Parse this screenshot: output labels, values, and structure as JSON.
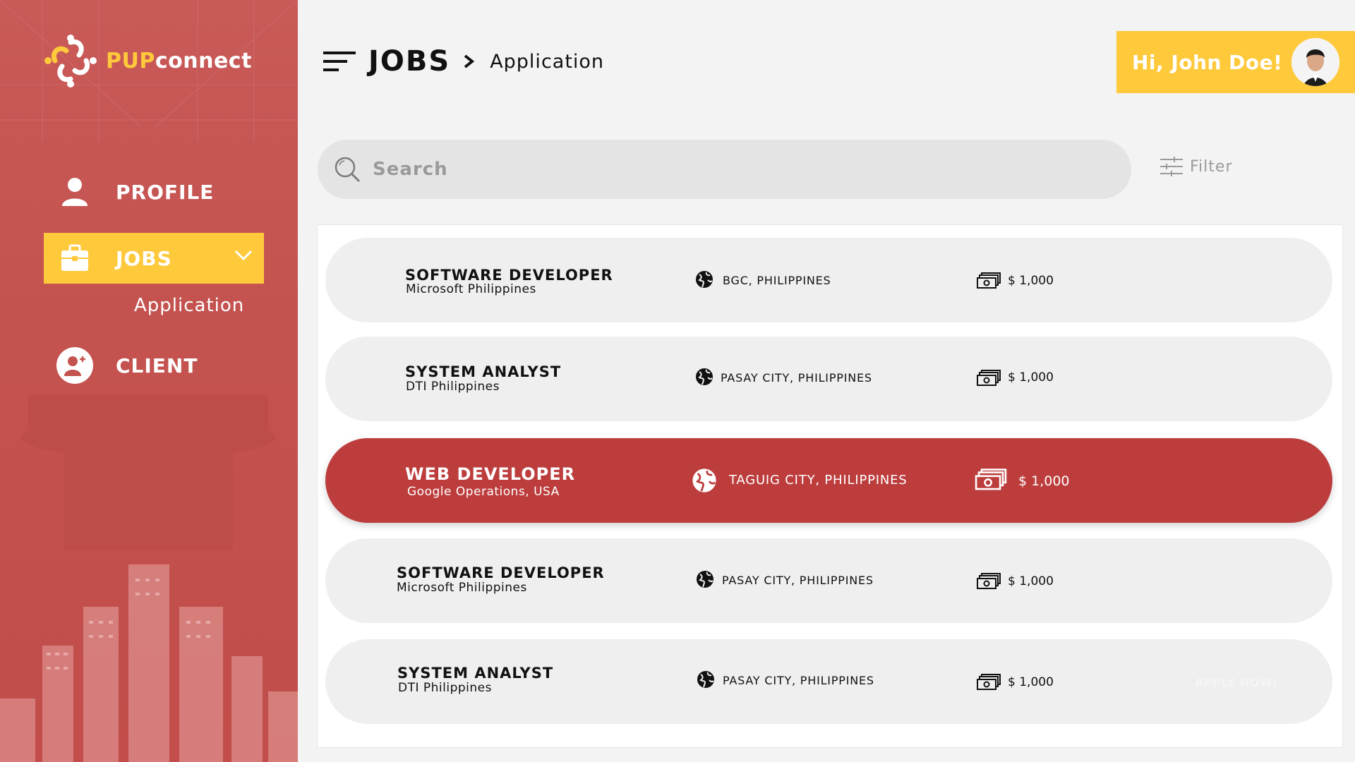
{
  "brand": {
    "logo_prefix": "PUP",
    "logo_suffix": "connect"
  },
  "nav": {
    "profile": "PROFILE",
    "jobs": "JOBS",
    "jobs_sub": "Application",
    "client": "CLIENT"
  },
  "header": {
    "breadcrumb_main": "JOBS",
    "breadcrumb_sub": "Application",
    "greeting": "Hi, John Doe!"
  },
  "search": {
    "placeholder": "Search",
    "value": ""
  },
  "filter": {
    "label": "Filter"
  },
  "jobs": [
    {
      "title": "SOFTWARE DEVELOPER",
      "company": "Microsoft Philippines",
      "location": "BGC, PHILIPPINES",
      "salary": "$ 1,000"
    },
    {
      "title": "SYSTEM ANALYST",
      "company": "DTI Philippines",
      "location": "PASAY CITY, PHILIPPINES",
      "salary": "$ 1,000"
    },
    {
      "title": "WEB DEVELOPER",
      "company": "Google Operations, USA",
      "location": "TAGUIG CITY, PHILIPPINES",
      "salary": "$ 1,000"
    },
    {
      "title": "SOFTWARE DEVELOPER",
      "company": "Microsoft Philippines",
      "location": "PASAY CITY, PHILIPPINES",
      "salary": "$ 1,000"
    },
    {
      "title": "SYSTEM ANALYST",
      "company": "DTI Philippines",
      "location": "PASAY CITY, PHILIPPINES",
      "salary": "$ 1,000",
      "apply": "APPLY NOW!"
    }
  ],
  "colors": {
    "sidebar": "#c4524f",
    "accent": "#ffc93c",
    "active_row": "#bd3d3d"
  }
}
